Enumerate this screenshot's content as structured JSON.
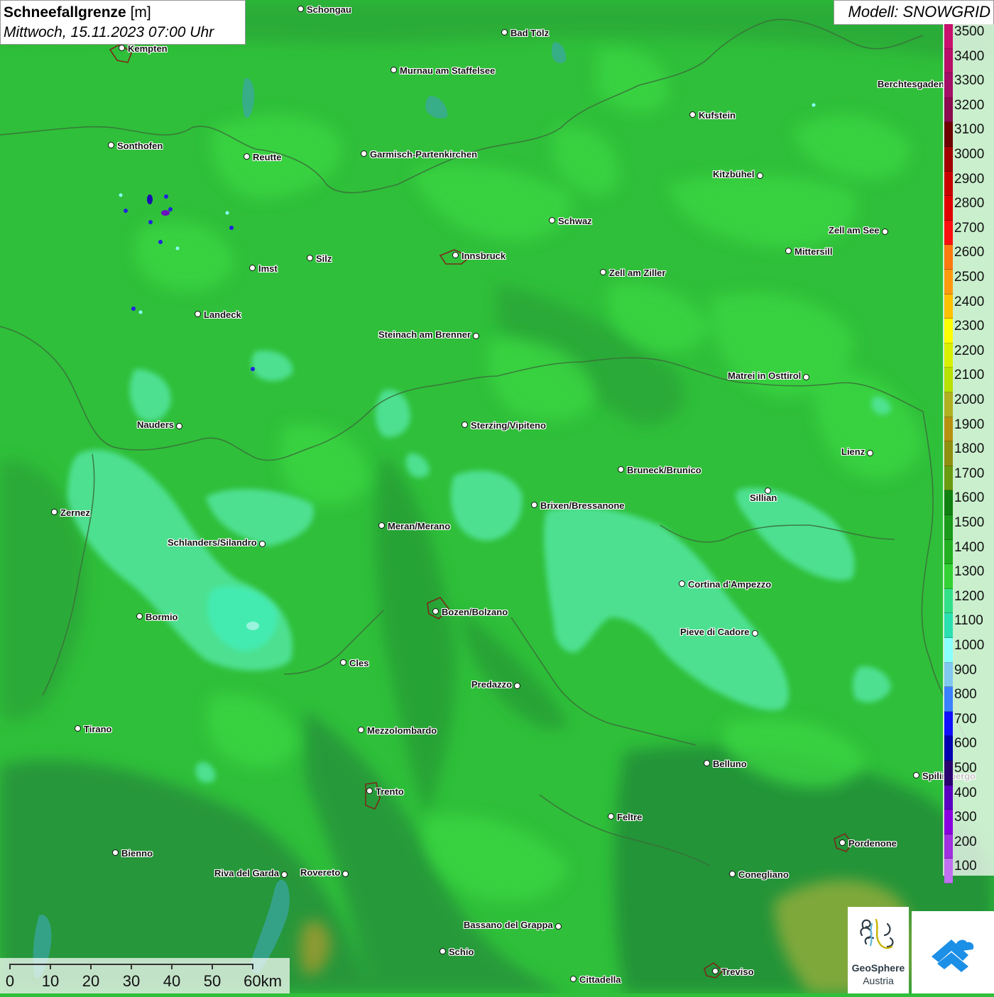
{
  "title": {
    "bold": "Schneefallgrenze",
    "unit": " [m]",
    "datetime": "Mittwoch, 15.11.2023 07:00 Uhr"
  },
  "model": "Modell: SNOWGRID",
  "legend": {
    "labels": [
      "3500",
      "3400",
      "3300",
      "3200",
      "3100",
      "3000",
      "2900",
      "2800",
      "2700",
      "2600",
      "2500",
      "2400",
      "2300",
      "2200",
      "2100",
      "2000",
      "1900",
      "1800",
      "1700",
      "1600",
      "1500",
      "1400",
      "1300",
      "1200",
      "1100",
      "1000",
      "900",
      "800",
      "700",
      "600",
      "500",
      "400",
      "300",
      "200",
      "100"
    ],
    "colors": [
      "#c8106e",
      "#b80f6a",
      "#a30f66",
      "#8c0a4f",
      "#6e0000",
      "#a00000",
      "#c80000",
      "#e00000",
      "#ff1010",
      "#ff7a10",
      "#ff9a10",
      "#ffc000",
      "#ffff00",
      "#d8f000",
      "#b8e000",
      "#b0b020",
      "#b89010",
      "#909010",
      "#6a9a10",
      "#108010",
      "#1a9a1a",
      "#22b022",
      "#33d133",
      "#33e08a",
      "#2ae0b0",
      "#8affff",
      "#80c8f0",
      "#3a80ff",
      "#1010ff",
      "#0000b0",
      "#2a0070",
      "#5a00c0",
      "#8a00e0",
      "#a030e0",
      "#c070f0"
    ]
  },
  "scale": {
    "labels": [
      "0",
      "10",
      "20",
      "30",
      "40",
      "50",
      "60km"
    ]
  },
  "logos": {
    "geosphere_line1": "GeoSphere",
    "geosphere_line2": "Austria"
  },
  "cities": [
    {
      "name": "Schongau",
      "dir": "r"
    },
    {
      "name": "Bad Tölz",
      "dir": "r"
    },
    {
      "name": "Kempten",
      "dir": "r"
    },
    {
      "name": "Murnau am Staffelsee",
      "dir": "r"
    },
    {
      "name": "Berchtesgaden",
      "dir": "l"
    },
    {
      "name": "Kufstein",
      "dir": "r"
    },
    {
      "name": "Sonthofen",
      "dir": "r"
    },
    {
      "name": "Reutte",
      "dir": "r"
    },
    {
      "name": "Garmisch-Partenkirchen",
      "dir": "r"
    },
    {
      "name": "Kitzbühel",
      "dir": "l"
    },
    {
      "name": "Schwaz",
      "dir": "r"
    },
    {
      "name": "Zell am See",
      "dir": "l"
    },
    {
      "name": "Innsbruck",
      "dir": "r"
    },
    {
      "name": "Mittersill",
      "dir": "r"
    },
    {
      "name": "Imst",
      "dir": "r"
    },
    {
      "name": "Silz",
      "dir": "r"
    },
    {
      "name": "Zell am Ziller",
      "dir": "r"
    },
    {
      "name": "Landeck",
      "dir": "r"
    },
    {
      "name": "Steinach am Brenner",
      "dir": "l"
    },
    {
      "name": "Matrei in Osttirol",
      "dir": "l"
    },
    {
      "name": "Nauders",
      "dir": "l"
    },
    {
      "name": "Sterzing/Vipiteno",
      "dir": "r"
    },
    {
      "name": "Lienz",
      "dir": "l"
    },
    {
      "name": "Bruneck/Brunico",
      "dir": "r"
    },
    {
      "name": "Sillian",
      "dir": "bl"
    },
    {
      "name": "Zernez",
      "dir": "r"
    },
    {
      "name": "Brixen/Bressanone",
      "dir": "r"
    },
    {
      "name": "Meran/Merano",
      "dir": "r"
    },
    {
      "name": "Schlanders/Silandro",
      "dir": "l"
    },
    {
      "name": "Cortina d'Ampezzo",
      "dir": "r"
    },
    {
      "name": "Bozen/Bolzano",
      "dir": "r"
    },
    {
      "name": "Bormio",
      "dir": "r"
    },
    {
      "name": "Pieve di Cadore",
      "dir": "l"
    },
    {
      "name": "Cles",
      "dir": "r"
    },
    {
      "name": "Predazzo",
      "dir": "l"
    },
    {
      "name": "Tirano",
      "dir": "r"
    },
    {
      "name": "Mezzolombardo",
      "dir": "r"
    },
    {
      "name": "Belluno",
      "dir": "r"
    },
    {
      "name": "Spilimbergo",
      "dir": "r"
    },
    {
      "name": "Trento",
      "dir": "r"
    },
    {
      "name": "Feltre",
      "dir": "r"
    },
    {
      "name": "Pordenone",
      "dir": "r"
    },
    {
      "name": "Bienno",
      "dir": "r"
    },
    {
      "name": "Riva del Garda",
      "dir": "l"
    },
    {
      "name": "Rovereto",
      "dir": "l"
    },
    {
      "name": "Conegliano",
      "dir": "r"
    },
    {
      "name": "Bassano del Grappa",
      "dir": "l"
    },
    {
      "name": "Schio",
      "dir": "r"
    },
    {
      "name": "Treviso",
      "dir": "r"
    },
    {
      "name": "Cittadella",
      "dir": "r"
    }
  ]
}
